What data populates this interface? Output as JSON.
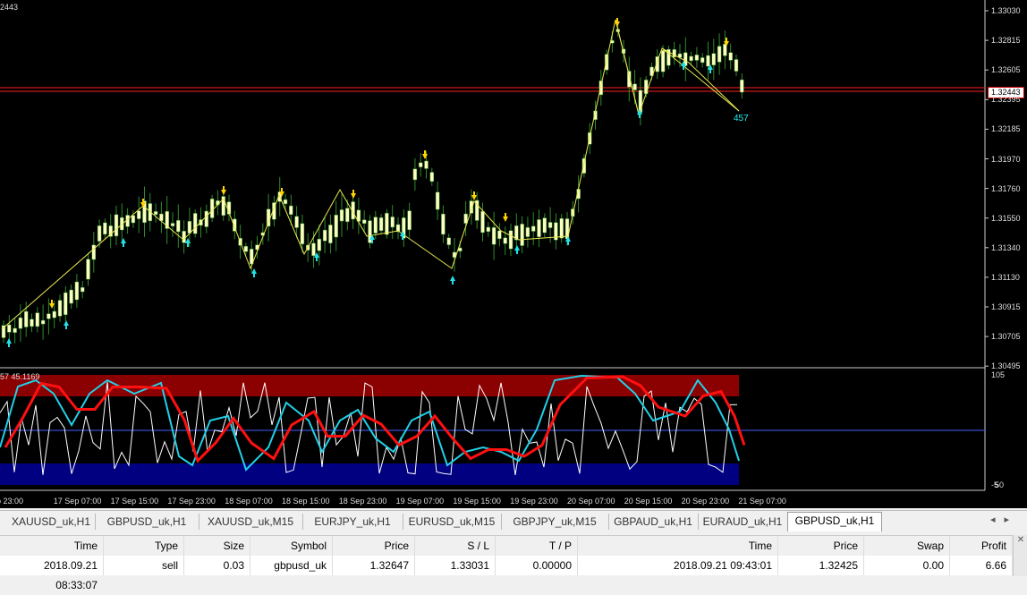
{
  "chart": {
    "symbol_label": "2443",
    "current_price": "1.32443",
    "zigzag_value": "457",
    "indicator_label": "57 45.1169",
    "price_axis": [
      "1.33030",
      "1.32815",
      "1.32605",
      "1.32395",
      "1.32185",
      "1.31970",
      "1.31760",
      "1.31550",
      "1.31340",
      "1.31130",
      "1.30915",
      "1.30705",
      "1.30495"
    ],
    "indicator_axis": [
      "105",
      "-5",
      "50"
    ],
    "time_axis": [
      "p 23:00",
      "17 Sep 07:00",
      "17 Sep 15:00",
      "17 Sep 23:00",
      "18 Sep 07:00",
      "18 Sep 15:00",
      "18 Sep 23:00",
      "19 Sep 07:00",
      "19 Sep 15:00",
      "19 Sep 23:00",
      "20 Sep 07:00",
      "20 Sep 15:00",
      "20 Sep 23:00",
      "21 Sep 07:00"
    ],
    "colors": {
      "bull": "#ffffc0",
      "bear": "#ffffc0",
      "wick": "#2e8b2e",
      "zigzag": "#e8e850",
      "sell_arrow": "#ffd400",
      "buy_arrow": "#22e0e8",
      "price_line": "#ff2020",
      "stoch_fast": "#22d0e8",
      "stoch_slow": "#ff1010",
      "overbought": "#8b0000",
      "oversold": "#000080"
    }
  },
  "tabs": [
    {
      "label": "XAUUSD_uk,H1",
      "active": false
    },
    {
      "label": "GBPUSD_uk,H1",
      "active": false
    },
    {
      "label": "XAUUSD_uk,M15",
      "active": false
    },
    {
      "label": "EURJPY_uk,H1",
      "active": false
    },
    {
      "label": "EURUSD_uk,M15",
      "active": false
    },
    {
      "label": "GBPJPY_uk,M15",
      "active": false
    },
    {
      "label": "GBPAUD_uk,H1",
      "active": false
    },
    {
      "label": "EURAUD_uk,H1",
      "active": false
    },
    {
      "label": "GBPUSD_uk,H1",
      "active": true
    }
  ],
  "trade": {
    "headers": [
      "Time",
      "Type",
      "Size",
      "Symbol",
      "Price",
      "S / L",
      "T / P",
      "Time",
      "Price",
      "Swap",
      "Profit"
    ],
    "row": [
      "2018.09.21 08:33:07",
      "sell",
      "0.03",
      "gbpusd_uk",
      "1.32647",
      "1.33031",
      "0.00000",
      "2018.09.21 09:43:01",
      "1.32425",
      "0.00",
      "6.66"
    ]
  }
}
